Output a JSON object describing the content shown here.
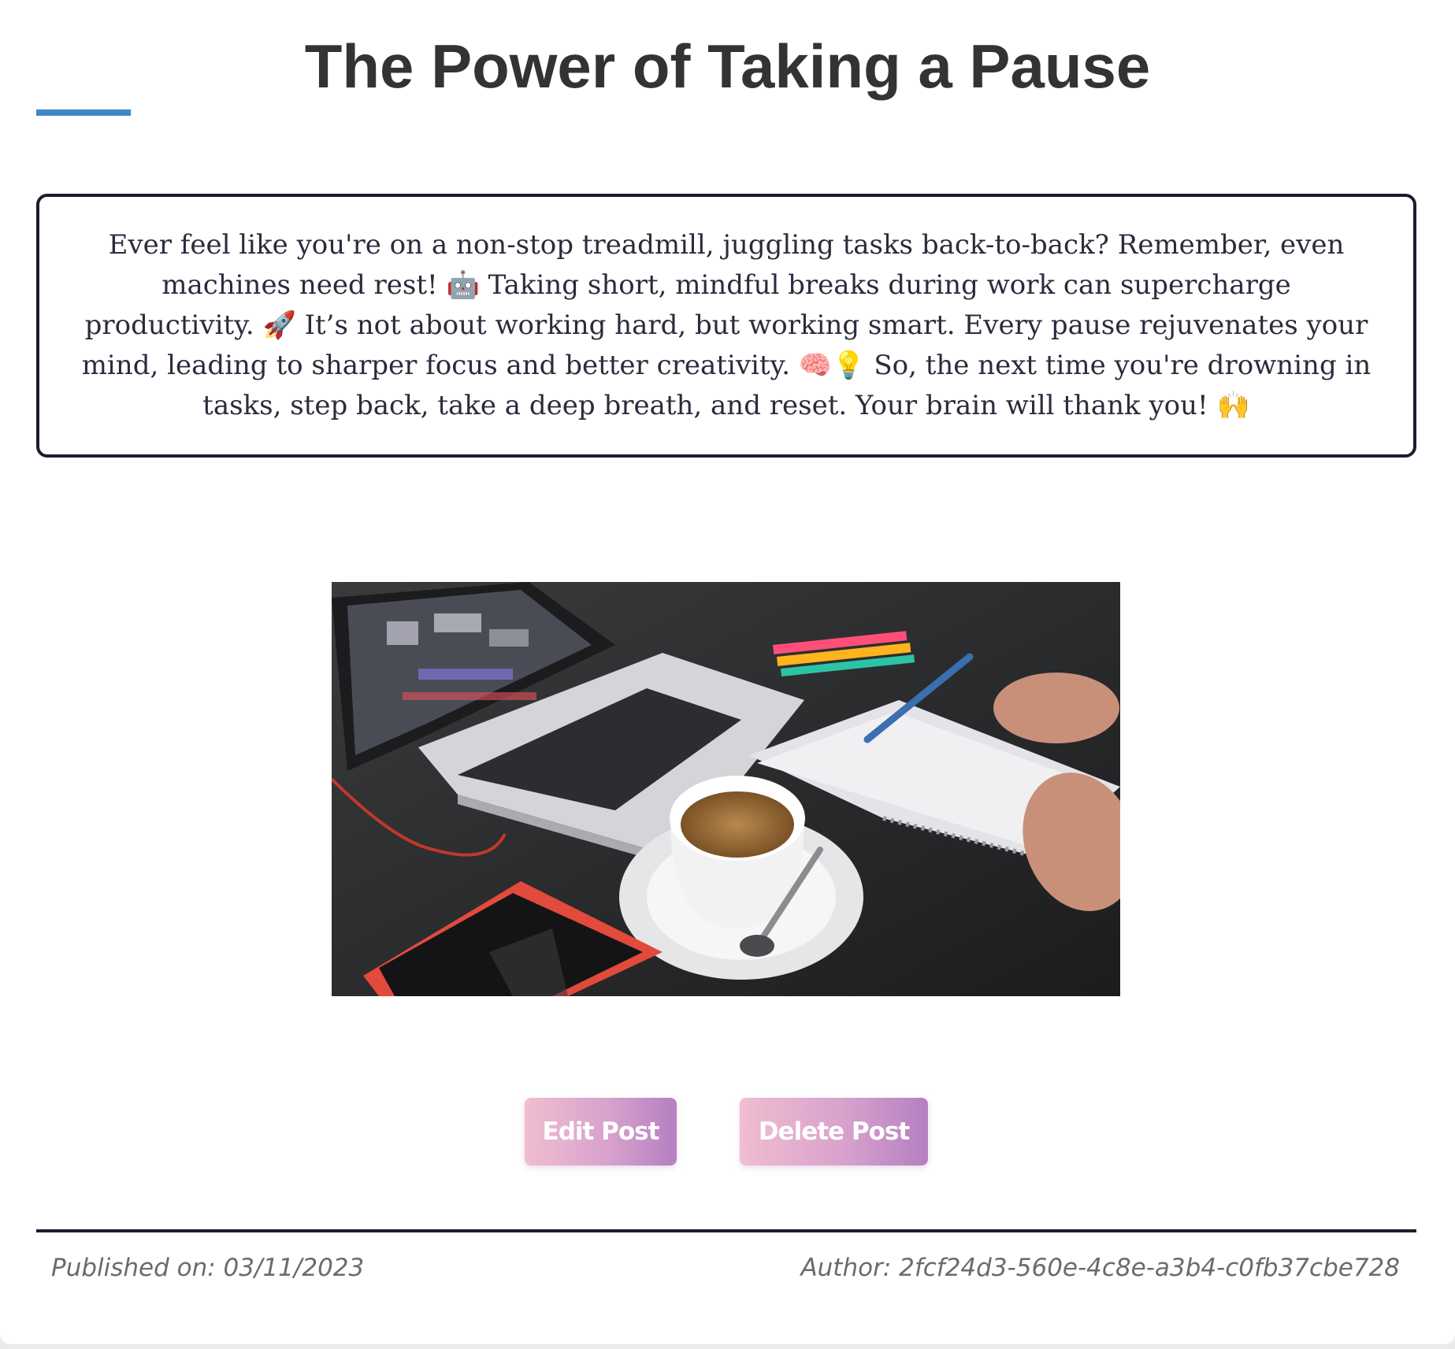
{
  "post": {
    "title": "The Power of Taking a Pause",
    "content": "Ever feel like you're on a non-stop treadmill, juggling tasks back-to-back? Remember, even machines need rest! 🤖 Taking short, mindful breaks during work can supercharge productivity. 🚀 It’s not about working hard, but working smart. Every pause rejuvenates your mind, leading to sharper focus and better creativity. 🧠💡 So, the next time you're drowning in tasks, step back, take a deep breath, and reset. Your brain will thank you! 🙌",
    "image_alt": "",
    "published": "Published on: 03/11/2023",
    "author": "Author: 2fcf24d3-560e-4c8e-a3b4-c0fb37cbe728"
  },
  "actions": {
    "edit_label": "Edit Post",
    "delete_label": "Delete Post"
  },
  "colors": {
    "accent": "#3d87c6",
    "border": "#1e1b2e",
    "button_gradient_start": "#f0bdd0",
    "button_gradient_end": "#b57fc2"
  }
}
